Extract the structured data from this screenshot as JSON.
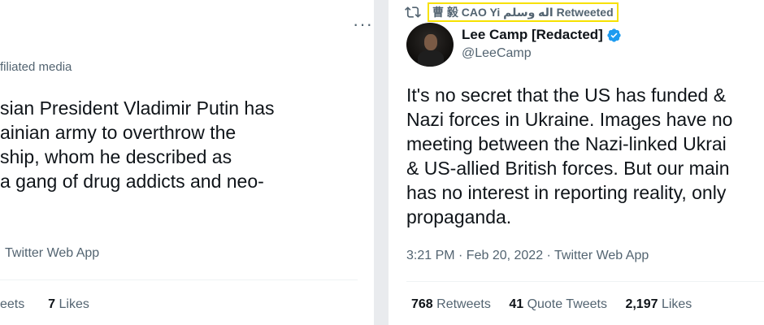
{
  "left_tweet": {
    "more_label": "···",
    "affiliation": "filiated media",
    "text_lines": [
      "sian President Vladimir Putin has",
      "ainian army to overthrow the",
      "ship, whom he described as",
      "a gang of drug addicts and neo-"
    ],
    "source": "Twitter Web App",
    "retweets_suffix": "eets",
    "likes_count": "7",
    "likes_label": "Likes"
  },
  "right_tweet": {
    "retweeted_by": "曹 毅 CAO Yi اله وسلم Retweeted",
    "author_name": "Lee Camp [Redacted]",
    "handle": "@LeeCamp",
    "text_lines": [
      "It's no secret that the US has funded &",
      "Nazi forces in Ukraine. Images have no",
      "meeting between the Nazi-linked Ukrai",
      "& US-allied British forces. But our main",
      "has no interest in reporting reality, only",
      "propaganda."
    ],
    "timestamp": "3:21 PM · Feb 20, 2022 · Twitter Web App",
    "stats": {
      "retweets_count": "768",
      "retweets_label": "Retweets",
      "quotes_count": "41",
      "quotes_label": "Quote Tweets",
      "likes_count": "2,197",
      "likes_label": "Likes"
    }
  },
  "colors": {
    "text": "#0f1419",
    "muted": "#536471",
    "verified": "#1d9bf0",
    "highlight": "#f7e100"
  },
  "icons": [
    "retweet-icon",
    "verified-badge-icon",
    "more-options-icon",
    "avatar"
  ]
}
